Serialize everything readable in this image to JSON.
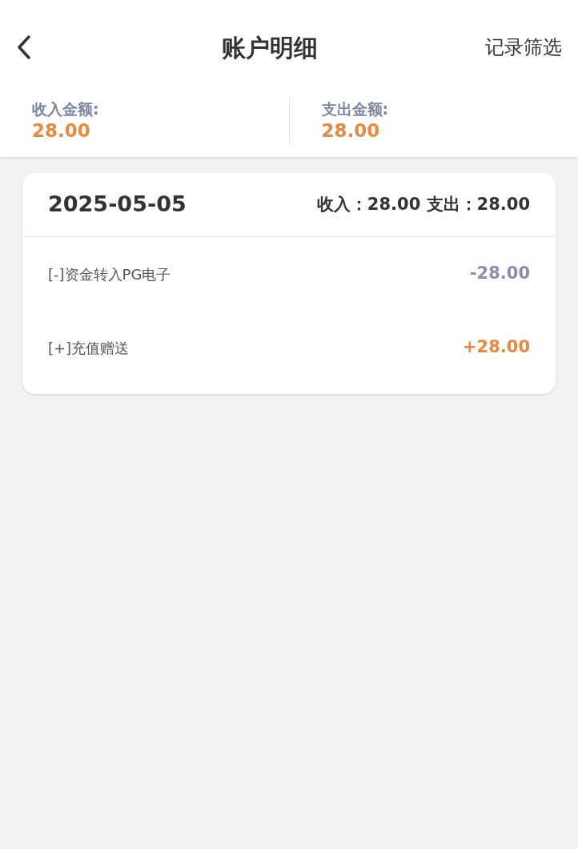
{
  "header": {
    "title": "账户明细",
    "action": "记录筛选"
  },
  "summary": [
    {
      "label": "收入金额:",
      "value": "28.00"
    },
    {
      "label": "支出金额:",
      "value": "28.00"
    }
  ],
  "day": {
    "date": "2025-05-05",
    "totals": "收入：28.00 支出：28.00",
    "transactions": [
      {
        "description": "[-]资金转入PG电子",
        "amount": "-28.00",
        "kind": "expense"
      },
      {
        "description": "[+]充值赠送",
        "amount": "+28.00",
        "kind": "income"
      }
    ]
  }
}
